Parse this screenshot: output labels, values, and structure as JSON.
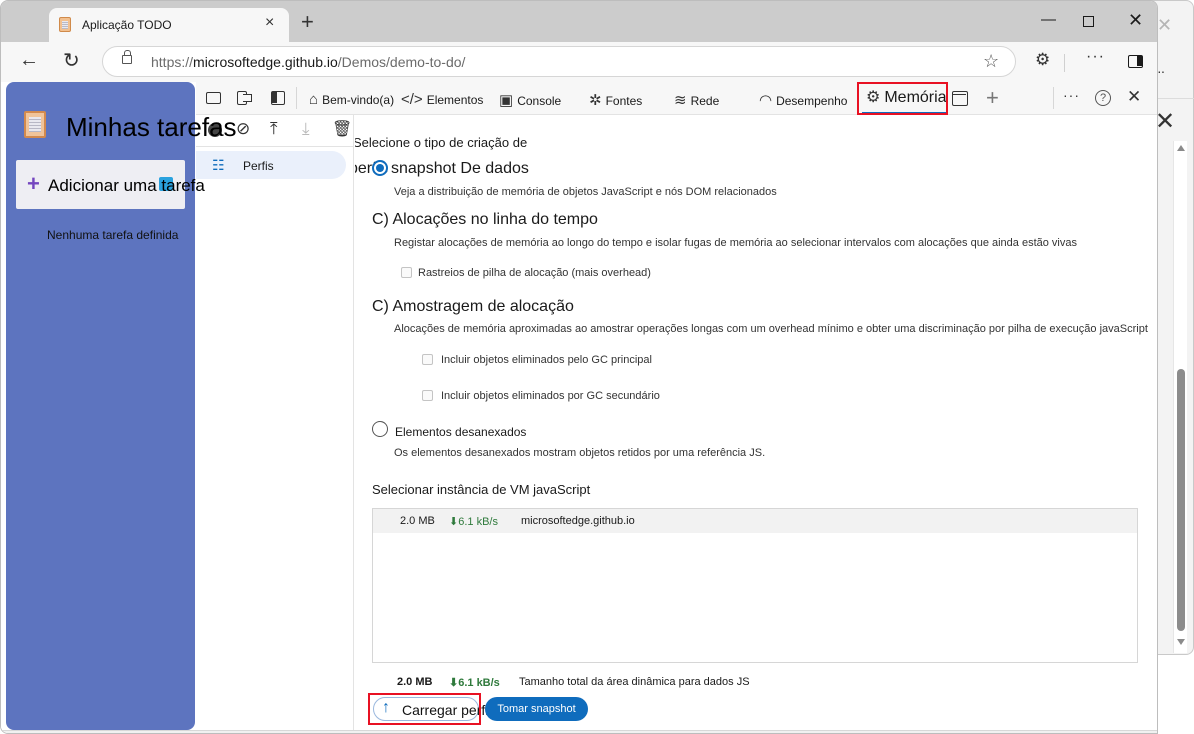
{
  "browser": {
    "tab_title": "Aplicação TODO",
    "url_prefix": "https://",
    "url_host": "microsoftedge.github.io",
    "url_path": "/Demos/demo-to-do/",
    "icons": {
      "tab_close": "×",
      "new_tab": "+",
      "minimize": "—",
      "close": "✕",
      "back": "←",
      "refresh": "↻",
      "favorite": "☆",
      "extensions": "⚙",
      "more": "···"
    }
  },
  "todo_app": {
    "title": "Minhas tarefas",
    "add_task_label": "Adicionar uma tarefa",
    "add_icon": "+",
    "empty_text": "Nenhuma tarefa definida",
    "panel_color": "#5d74bf"
  },
  "devtools": {
    "tabs": [
      {
        "label": "Bem-vindo(a)",
        "icon": "⌂"
      },
      {
        "label": "Elementos",
        "icon": "</>"
      },
      {
        "label": "Console",
        "icon": "▣"
      },
      {
        "label": "Fontes",
        "icon": "✲"
      },
      {
        "label": "Rede",
        "icon": "≋"
      },
      {
        "label": "Desempenho",
        "icon": "◠"
      },
      {
        "label": "Memória",
        "icon": "⚙",
        "active": true
      }
    ],
    "more_icon": "···",
    "help_icon": "?",
    "close_icon": "✕",
    "add_tab_icon": "+",
    "accent_color": "#0f6cbd",
    "highlight_color": "#e81123",
    "left_toolbar": {
      "clear_icon": "⊘",
      "upload_icon": "⤒",
      "download_icon": "⤓",
      "trash_icon": "🗑"
    },
    "profiles_label": "Perfis",
    "profiles_icon": "☷",
    "memory": {
      "select_heading": "Selecione o tipo de criação de",
      "overlap_text": "perfis",
      "options": [
        {
          "title": "snapshot De dados",
          "desc": "Veja a distribuição de memória de objetos JavaScript e nós DOM relacionados",
          "selected": true
        },
        {
          "title": "C) Alocações no linha do tempo",
          "desc": "Registar alocações de memória ao longo do tempo e isolar fugas de memória ao selecionar intervalos com alocações que ainda estão vivas",
          "checkboxes": [
            "Rastreios de pilha de alocação (mais overhead)"
          ],
          "selected": false
        },
        {
          "title": "C) Amostragem de alocação",
          "desc": "Alocações de memória aproximadas ao amostrar operações longas com um overhead mínimo e obter uma discriminação por pilha de execução javaScript",
          "checkboxes": [
            "Incluir objetos eliminados pelo GC principal",
            "Incluir objetos eliminados por GC secundário"
          ],
          "selected": false
        },
        {
          "title": "Elementos desanexados",
          "desc": "Os elementos desanexados mostram objetos retidos por uma referência JS.",
          "selected": false
        }
      ],
      "vm_heading": "Selecionar instância de VM javaScript",
      "vm_instances": [
        {
          "size": "2.0 MB",
          "rate": "⬇6.1 kB/s",
          "name": "microsoftedge.github.io"
        }
      ],
      "total": {
        "size": "2.0 MB",
        "rate": "⬇6.1 kB/s",
        "label": "Tamanho total da área dinâmica para dados JS"
      },
      "load_button": "Carregar perfil",
      "load_icon": "↑",
      "snapshot_button": "Tomar snapshot"
    }
  }
}
